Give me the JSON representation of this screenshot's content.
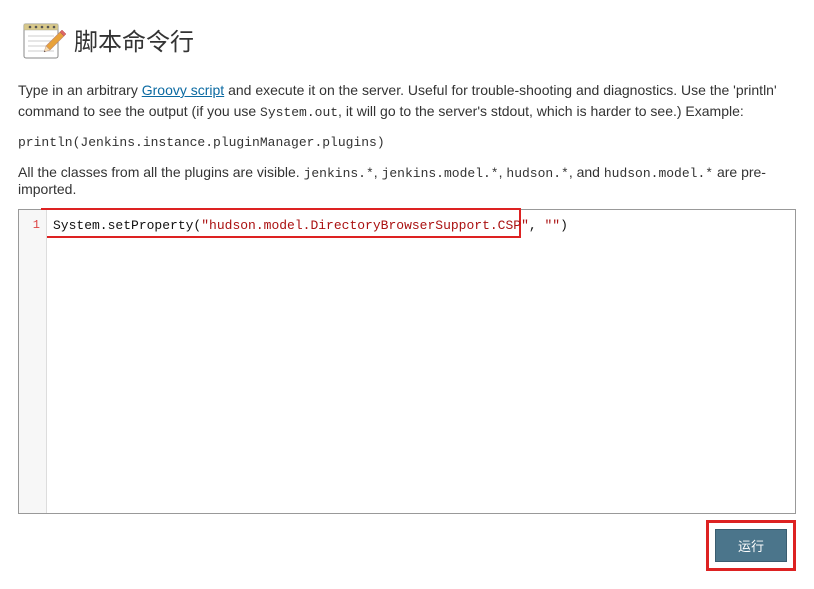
{
  "header": {
    "title": "脚本命令行"
  },
  "description": {
    "prefix": "Type in an arbitrary ",
    "link_text": "Groovy script",
    "middle": " and execute it on the server. Useful for trouble-shooting and diagnostics. Use the 'println' command to see the output (if you use ",
    "mono1": "System.out",
    "suffix": ", it will go to the server's stdout, which is harder to see.) Example:"
  },
  "example": "println(Jenkins.instance.pluginManager.plugins)",
  "second_description": {
    "prefix": "All the classes from all the plugins are visible. ",
    "pkg1": "jenkins.*",
    "c1": ", ",
    "pkg2": "jenkins.model.*",
    "c2": ", ",
    "pkg3": "hudson.*",
    "c3": ", and ",
    "pkg4": "hudson.model.*",
    "suffix": " are pre-imported."
  },
  "editor": {
    "line_number": "1",
    "code_prefix": "System.setProperty(",
    "code_string": "\"hudson.model.DirectoryBrowserSupport.CSP\"",
    "code_mid": ", ",
    "code_string2": "\"\"",
    "code_suffix": ")"
  },
  "buttons": {
    "run": "运行"
  }
}
